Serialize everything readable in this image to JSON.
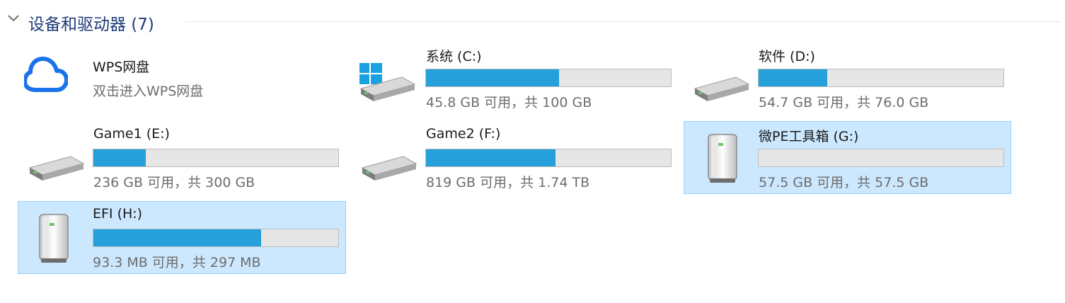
{
  "group": {
    "title": "设备和驱动器 (7)"
  },
  "wps": {
    "name": "WPS网盘",
    "subtitle": "双击进入WPS网盘"
  },
  "drives": [
    {
      "name": "系统 (C:)",
      "status": "45.8 GB 可用，共 100 GB",
      "used_fraction": 0.542,
      "icon": "windows-drive-icon",
      "selected": false
    },
    {
      "name": "软件 (D:)",
      "status": "54.7 GB 可用，共 76.0 GB",
      "used_fraction": 0.28,
      "icon": "hard-drive-icon",
      "selected": false
    },
    {
      "name": "Game1 (E:)",
      "status": "236 GB 可用，共 300 GB",
      "used_fraction": 0.213,
      "icon": "hard-drive-icon",
      "selected": false
    },
    {
      "name": "Game2 (F:)",
      "status": "819 GB 可用，共 1.74 TB",
      "used_fraction": 0.53,
      "icon": "hard-drive-icon",
      "selected": false
    },
    {
      "name": "微PE工具箱 (G:)",
      "status": "57.5 GB 可用，共 57.5 GB",
      "used_fraction": 0.0,
      "icon": "removable-drive-icon",
      "selected": true
    },
    {
      "name": "EFI (H:)",
      "status": "93.3 MB 可用，共 297 MB",
      "used_fraction": 0.686,
      "icon": "removable-drive-icon",
      "selected": true
    }
  ],
  "colors": {
    "bar_fill": "#26a0da",
    "selection": "#cce8ff",
    "header_text": "#1e3a78",
    "wps_cloud": "#1a73e8"
  }
}
